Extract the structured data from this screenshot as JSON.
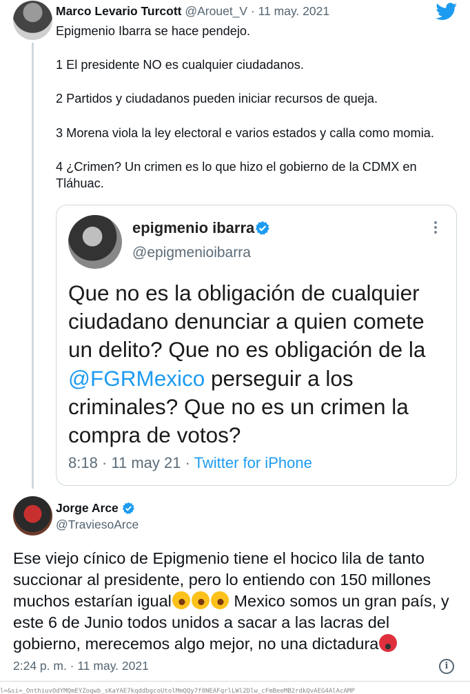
{
  "tweet1": {
    "name": "Marco Levario Turcott",
    "handle_meta": " @Arouet_V · 11 may. 2021",
    "paragraphs": [
      "Epigmenio Ibarra se hace pendejo.",
      "",
      "1 El presidente NO es cualquier ciudadanos.",
      "",
      "2 Partidos y ciudadanos pueden iniciar recursos de queja.",
      "",
      "3 Morena viola la ley electoral e varios estados y calla como momia.",
      "",
      "4 ¿Crimen? Un crimen es lo que hizo el gobierno de la CDMX en Tláhuac."
    ]
  },
  "quote": {
    "name": "epigmenio ibarra",
    "handle": "@epigmenioibarra",
    "text_before": "Que no es la obligación de cualquier ciudadano denunciar a quien comete un delito? Que no es obligación de la ",
    "mention": "@FGRMexico",
    "text_after": " perseguir a los criminales? Que no es un crimen la compra de votos?",
    "time_date": "8:18 · 11 may 21 · ",
    "source": "Twitter for iPhone"
  },
  "tweet2": {
    "name": "Jorge Arce",
    "handle": "@TraviesoArce",
    "text_part1": "Ese viejo cínico de Epigmenio tiene el hocico lila de tanto succionar al presidente, pero lo entiendo con 150 millones muchos estarían igual",
    "text_part2": " Mexico somos un gran país, y este 6 de Junio todos unidos a sacar a las lacras del gobierno, merecemos algo mejor, no una dictadura",
    "emoji_laugh": "rolling-on-floor-laughing-emoji",
    "emoji_angry": "face-with-symbols-on-mouth-emoji",
    "timestamp": "2:24 p. m. · 11 may. 2021",
    "info": "i"
  },
  "url_strip": "l=&si=_OnthiuvOdYMQmEYZoqwb_sKaYAE7kqddbgcoUtolMmQQy7f0NEAFqrlLWl2Dlw_cFmBeeMB2rdkQvAEG4AlAcAMP",
  "colors": {
    "accent": "#1d9bf0",
    "muted": "#536471",
    "border": "#cfd9de"
  }
}
